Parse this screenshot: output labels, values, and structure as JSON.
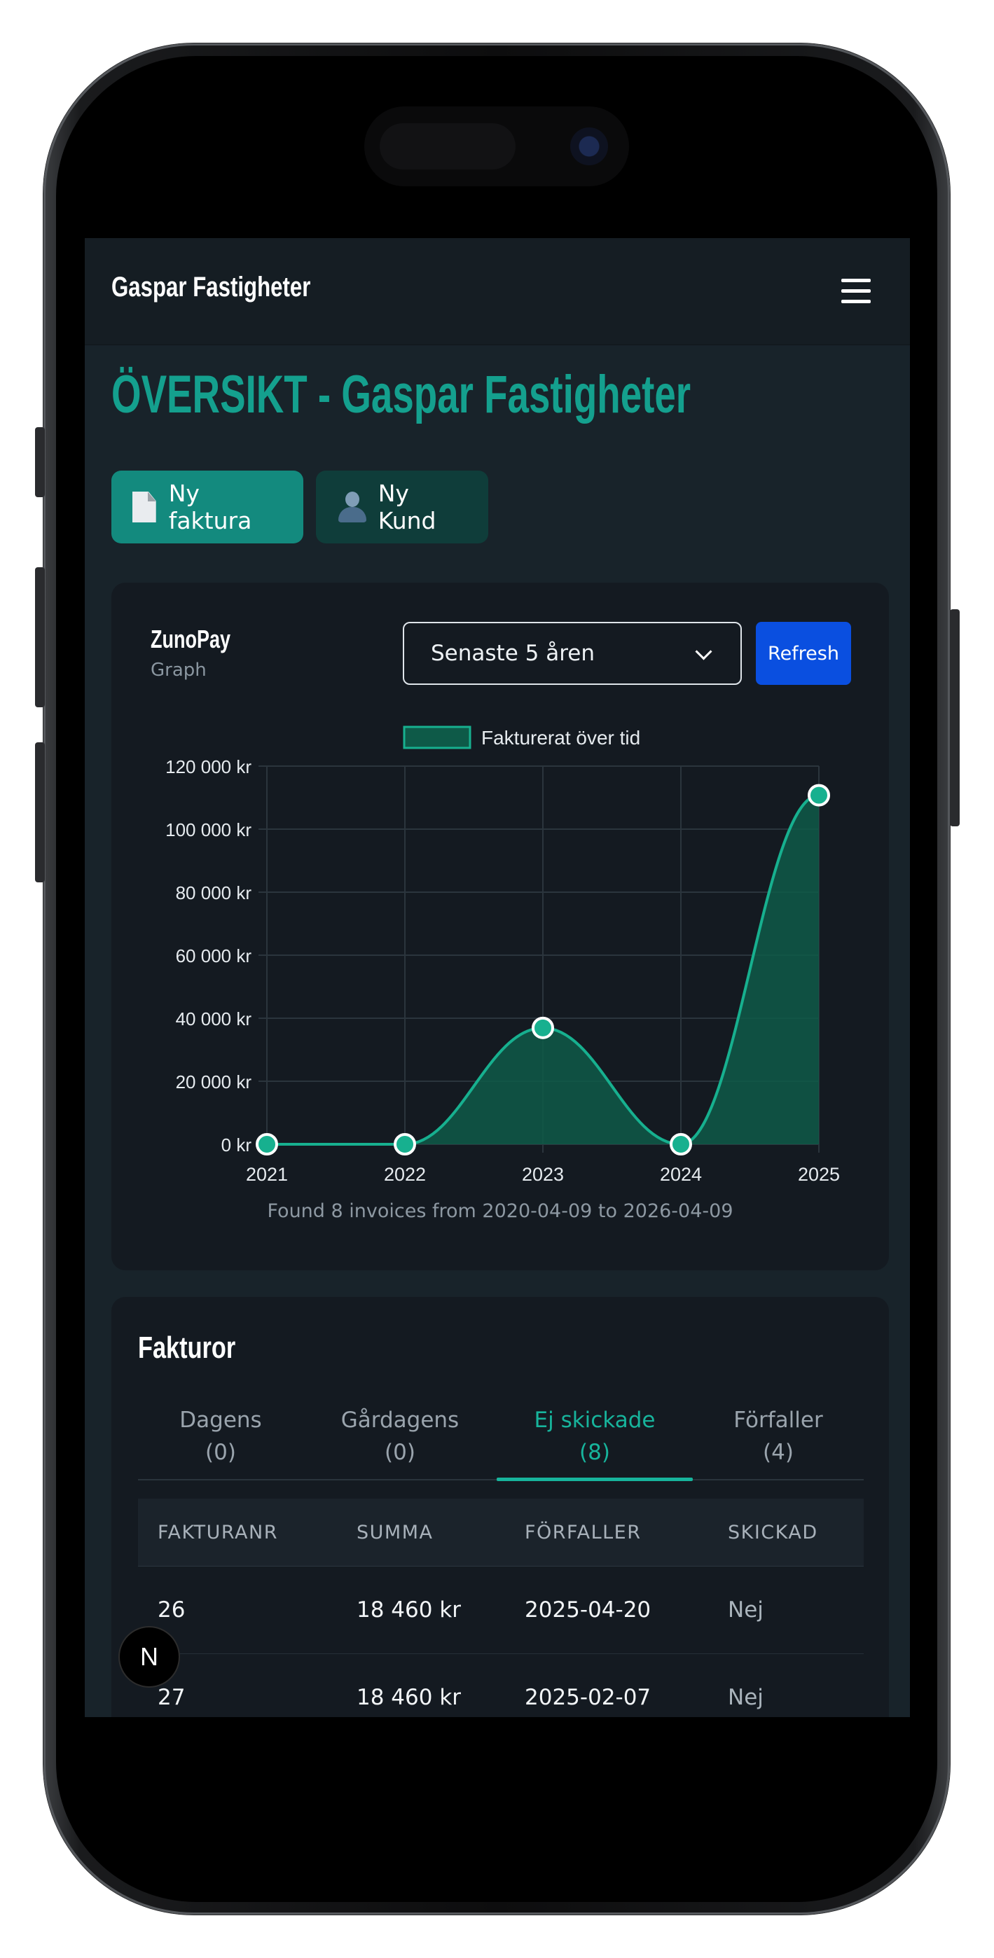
{
  "navbar": {
    "brand": "Gaspar Fastigheter"
  },
  "page": {
    "title": "ÖVERSIKT - Gaspar Fastigheter",
    "new_invoice_label": "Ny faktura",
    "new_customer_label": "Ny Kund"
  },
  "chart_card": {
    "title": "ZunoPay",
    "subtitle": "Graph",
    "range_select": "Senaste 5 åren",
    "refresh_label": "Refresh",
    "found_text": "Found 8 invoices from 2020-04-09 to 2026-04-09"
  },
  "chart_data": {
    "type": "area",
    "categories": [
      "2021",
      "2022",
      "2023",
      "2024",
      "2025"
    ],
    "series": [
      {
        "name": "Fakturerat över tid",
        "values": [
          0,
          0,
          36920,
          0,
          110760
        ]
      }
    ],
    "y_ticks": [
      "0 kr",
      "20 000 kr",
      "40 000 kr",
      "60 000 kr",
      "80 000 kr",
      "100 000 kr",
      "120 000 kr"
    ],
    "ylim": [
      0,
      120000
    ],
    "legend": "top-center",
    "grid": true,
    "colors": {
      "line": "#17b08f",
      "fill": "#0e5a48",
      "grid": "#2b353d",
      "text": "#e6ebef"
    }
  },
  "invoices": {
    "title": "Fakturor",
    "tabs": [
      {
        "label": "Dagens",
        "count": "(0)"
      },
      {
        "label": "Gårdagens",
        "count": "(0)"
      },
      {
        "label": "Ej skickade",
        "count": "(8)"
      },
      {
        "label": "Förfaller",
        "count": "(4)"
      }
    ],
    "columns": [
      "FAKTURANR",
      "SUMMA",
      "FÖRFALLER",
      "SKICKAD"
    ],
    "rows": [
      [
        "26",
        "18 460 kr",
        "2025-04-20",
        "Nej"
      ],
      [
        "27",
        "18 460 kr",
        "2025-02-07",
        "Nej"
      ]
    ]
  },
  "next_badge": "N"
}
